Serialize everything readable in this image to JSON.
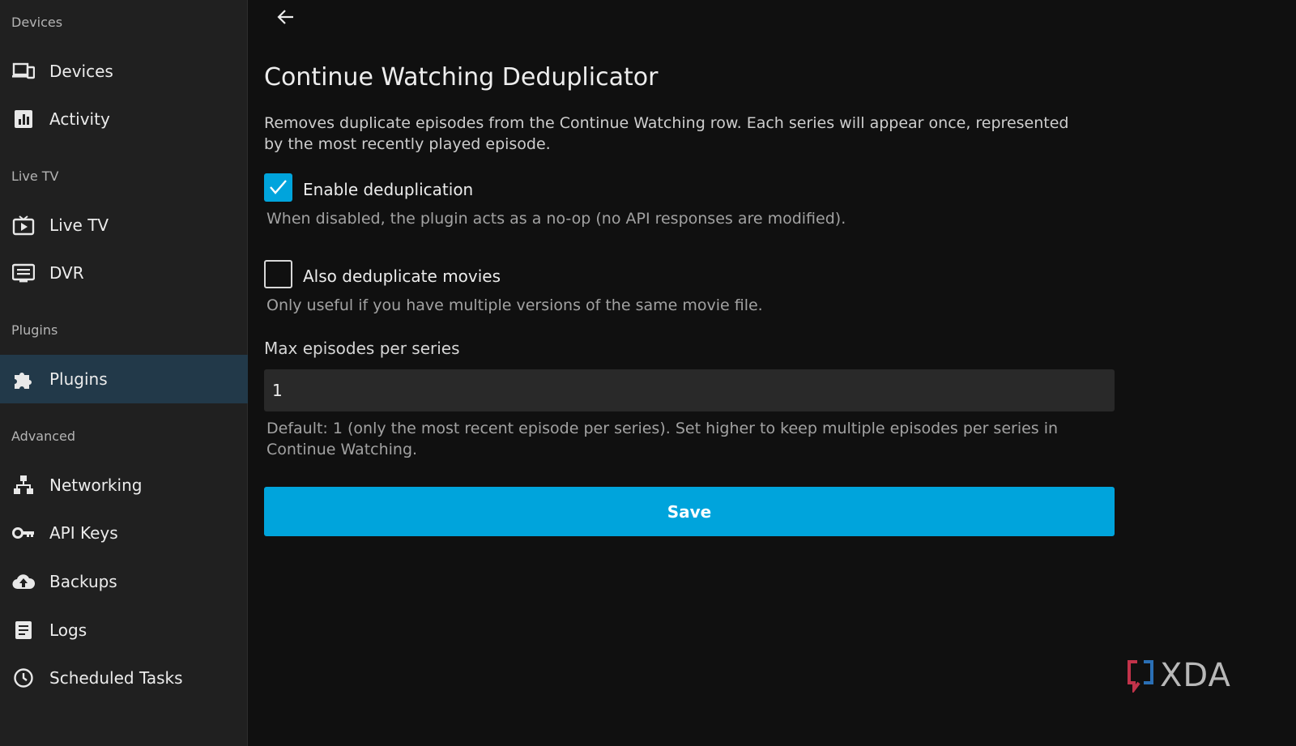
{
  "sidebar": {
    "sections": [
      {
        "header": "Devices",
        "items": [
          {
            "label": "Devices",
            "icon": "devices-icon"
          },
          {
            "label": "Activity",
            "icon": "activity-icon"
          }
        ]
      },
      {
        "header": "Live TV",
        "items": [
          {
            "label": "Live TV",
            "icon": "live-tv-icon"
          },
          {
            "label": "DVR",
            "icon": "dvr-icon"
          }
        ]
      },
      {
        "header": "Plugins",
        "items": [
          {
            "label": "Plugins",
            "icon": "puzzle-icon",
            "active": true
          }
        ]
      },
      {
        "header": "Advanced",
        "items": [
          {
            "label": "Networking",
            "icon": "network-icon"
          },
          {
            "label": "API Keys",
            "icon": "key-icon"
          },
          {
            "label": "Backups",
            "icon": "cloud-upload-icon"
          },
          {
            "label": "Logs",
            "icon": "logs-icon"
          },
          {
            "label": "Scheduled Tasks",
            "icon": "clock-icon"
          }
        ]
      }
    ]
  },
  "page": {
    "title": "Continue Watching Deduplicator",
    "description": "Removes duplicate episodes from the Continue Watching row. Each series will appear once, represented by the most recently played episode.",
    "enable_dedup": {
      "label": "Enable deduplication",
      "checked": true,
      "helper": "When disabled, the plugin acts as a no-op (no API responses are modified)."
    },
    "dedup_movies": {
      "label": "Also deduplicate movies",
      "checked": false,
      "helper": "Only useful if you have multiple versions of the same movie file."
    },
    "max_episodes": {
      "label": "Max episodes per series",
      "value": "1",
      "helper": "Default: 1 (only the most recent episode per series). Set higher to keep multiple episodes per series in Continue Watching."
    },
    "save_label": "Save"
  },
  "watermark": {
    "text": "XDA"
  },
  "colors": {
    "accent": "#00a4dc",
    "sidebar_bg": "#202020",
    "active_item_bg": "#223949",
    "page_bg": "#101010"
  }
}
